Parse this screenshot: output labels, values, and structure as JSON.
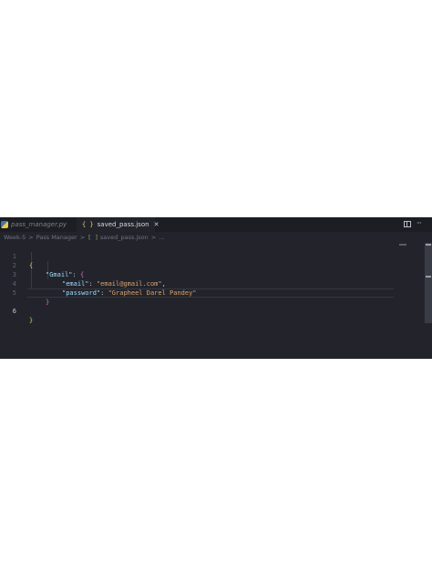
{
  "tabs": [
    {
      "label": "pass_manager.py",
      "icon": "python-icon",
      "active": false
    },
    {
      "label": "saved_pass.json",
      "icon": "json-braces-icon",
      "active": true,
      "close": "✕"
    }
  ],
  "tab_icons": {
    "json": "{ }"
  },
  "toolbar": {
    "more": "···"
  },
  "breadcrumb": {
    "items": [
      "Week-5",
      "Pass Manager",
      "saved_pass.json",
      "..."
    ],
    "separator": ">",
    "json_icon": "[ ]"
  },
  "code": {
    "line_numbers": [
      "1",
      "2",
      "3",
      "4",
      "5",
      "6"
    ],
    "current_line": 6,
    "lines": {
      "l1_open": "{",
      "l2_key": "\"Gmail\"",
      "l2_colon": ": ",
      "l2_open": "{",
      "l3_key": "\"email\"",
      "l3_colon": ": ",
      "l3_value": "\"email@gmail.com\"",
      "l3_comma": ",",
      "l4_key": "\"password\"",
      "l4_colon": ": ",
      "l4_value": "\"Grapheel Darel Pandey\"",
      "l5_close": "}",
      "l6_close": "}"
    }
  },
  "colors": {
    "editor_bg": "#23242b",
    "tab_bar_bg": "#1d1e24",
    "brace_level1": "#e2c75c",
    "brace_level2": "#d56cc8",
    "json_key": "#9cdcfe",
    "json_string": "#d8a36d"
  }
}
